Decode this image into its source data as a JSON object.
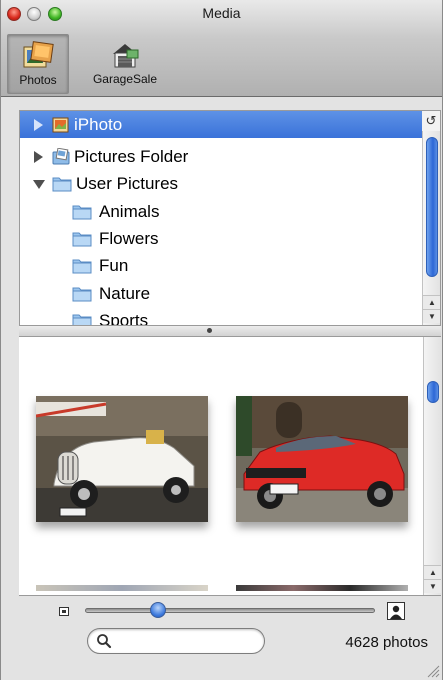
{
  "window": {
    "title": "Media"
  },
  "toolbar": {
    "items": [
      {
        "label": "Photos",
        "selected": true,
        "icon": "photos-icon"
      },
      {
        "label": "GarageSale",
        "selected": false,
        "icon": "garagesale-icon"
      }
    ]
  },
  "sources": {
    "items": [
      {
        "label": "iPhoto",
        "expanded": false,
        "selected": true,
        "icon": "iphoto-icon"
      },
      {
        "label": "Pictures Folder",
        "expanded": false,
        "selected": false,
        "icon": "pictures-folder-icon"
      },
      {
        "label": "User Pictures",
        "expanded": true,
        "selected": false,
        "icon": "folder-icon"
      },
      {
        "label": "Animals",
        "icon": "folder-icon"
      },
      {
        "label": "Flowers",
        "icon": "folder-icon"
      },
      {
        "label": "Fun",
        "icon": "folder-icon"
      },
      {
        "label": "Nature",
        "icon": "folder-icon"
      },
      {
        "label": "Sports",
        "icon": "folder-icon"
      }
    ]
  },
  "photos": {
    "thumbnails": [
      {
        "subject": "white vintage convertible car",
        "icon": "photo-thumbnail"
      },
      {
        "subject": "red sports car",
        "icon": "photo-thumbnail"
      }
    ]
  },
  "zoom": {
    "value_fraction": 0.25,
    "small_icon": "small-photo-icon",
    "large_icon": "large-photo-icon"
  },
  "search": {
    "value": "",
    "placeholder": "",
    "icon": "search-icon"
  },
  "status": {
    "photo_count": "4628 photos"
  },
  "colors": {
    "selection": "#3a72d9",
    "scroll_thumb": "#2d67d6"
  }
}
